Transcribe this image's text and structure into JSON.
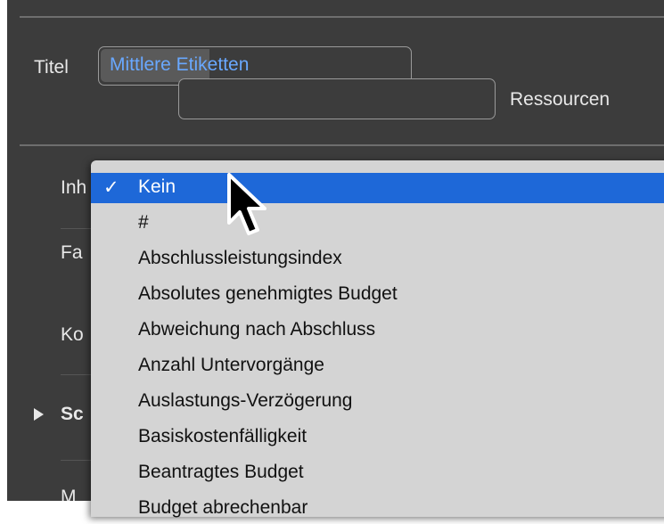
{
  "form": {
    "title_label": "Titel",
    "title_value": "Mittlere Etiketten",
    "resources_label": "Ressourcen"
  },
  "sidebar_labels": {
    "content_partial": "Inh",
    "color_partial": "Fa",
    "contour_partial": "Ko",
    "section_partial": "Sc",
    "bottom_partial": "M"
  },
  "menu": {
    "check_mark": "✓",
    "items": [
      "Kein",
      "#",
      "Abschlussleistungsindex",
      "Absolutes genehmigtes Budget",
      "Abweichung nach Abschluss",
      "Anzahl Untervorgänge",
      "Auslastungs-Verzögerung",
      "Basiskostenfälligkeit",
      "Beantragtes Budget",
      "Budget abrechenbar"
    ],
    "selected": "Kein"
  },
  "colors": {
    "panel_bg": "#3c3c3c",
    "menu_bg": "#d4d4d4",
    "selection": "#1e68d8",
    "field_text": "#69a8ff"
  }
}
